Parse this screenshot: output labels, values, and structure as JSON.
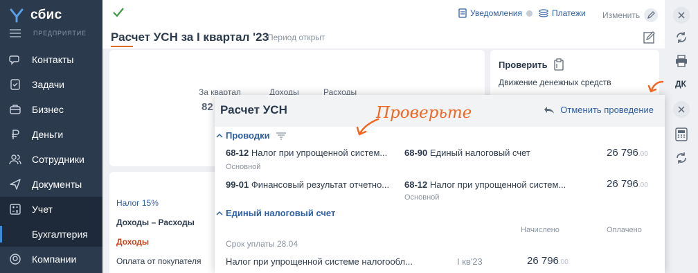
{
  "colors": {
    "sidebar": "#2b3a4d",
    "accent_orange": "#f26622",
    "link_blue": "#2d5fa6",
    "check_green": "#3b9b3f"
  },
  "app": {
    "logo_text": "сбис",
    "org_label": "ПРЕДПРИЯТИЕ"
  },
  "sidebar": {
    "items": [
      {
        "label": "Контакты",
        "icon": "chat-icon"
      },
      {
        "label": "Задачи",
        "icon": "tasks-icon"
      },
      {
        "label": "Бизнес",
        "icon": "business-icon"
      },
      {
        "label": "Деньги",
        "icon": "ruble-icon"
      },
      {
        "label": "Сотрудники",
        "icon": "people-icon"
      },
      {
        "label": "Документы",
        "icon": "send-icon"
      },
      {
        "label": "Учет",
        "icon": "calculator-icon"
      },
      {
        "label": "Бухгалтерия"
      },
      {
        "label": "Компании",
        "icon": "company-icon"
      }
    ]
  },
  "header": {
    "notifications": "Уведомления",
    "payments": "Платежи",
    "change": "Изменить",
    "title": "Расчет УСН за I квартал '23",
    "period_status": "Период открыт"
  },
  "summary": {
    "col1": "За квартал",
    "col2": "Доходы",
    "col3": "Расходы",
    "value_partial": "82"
  },
  "right_card": {
    "check_label": "Проверить",
    "cash_flow": "Движение денежных средств"
  },
  "left_list": {
    "items": [
      "Налог 15%",
      "Доходы – Расходы",
      "Доходы",
      "Оплата от покупателя"
    ]
  },
  "rail": {
    "dk_label": "ДК"
  },
  "panel": {
    "title": "Расчет УСН",
    "undo_label": "Отменить проведение",
    "postings_title": "Проводки",
    "postings": [
      {
        "debit_code": "68-12",
        "debit_name": "Налог при упрощенной систем...",
        "debit_sub": "Основной",
        "credit_code": "68-90",
        "credit_name": "Единый налоговый счет",
        "credit_sub": "",
        "amount": "26 796",
        "kopecks": ".00"
      },
      {
        "debit_code": "99-01",
        "debit_name": "Финансовый результат отчетно...",
        "debit_sub": "",
        "credit_code": "68-12",
        "credit_name": "Налог при упрощенной систем...",
        "credit_sub": "Основной",
        "amount": "26 796",
        "kopecks": ".00"
      }
    ],
    "ens_title": "Единый налоговый счет",
    "col_accrued": "Начислено",
    "col_paid": "Оплачено",
    "due_date": "Срок уплаты 28.04",
    "tax_row": {
      "name": "Налог при упрощенной системе налогообл...",
      "quarter": "I кв'23",
      "amount": "26 796",
      "kopecks": ".00"
    }
  },
  "annotation": {
    "text": "Проверьте"
  }
}
